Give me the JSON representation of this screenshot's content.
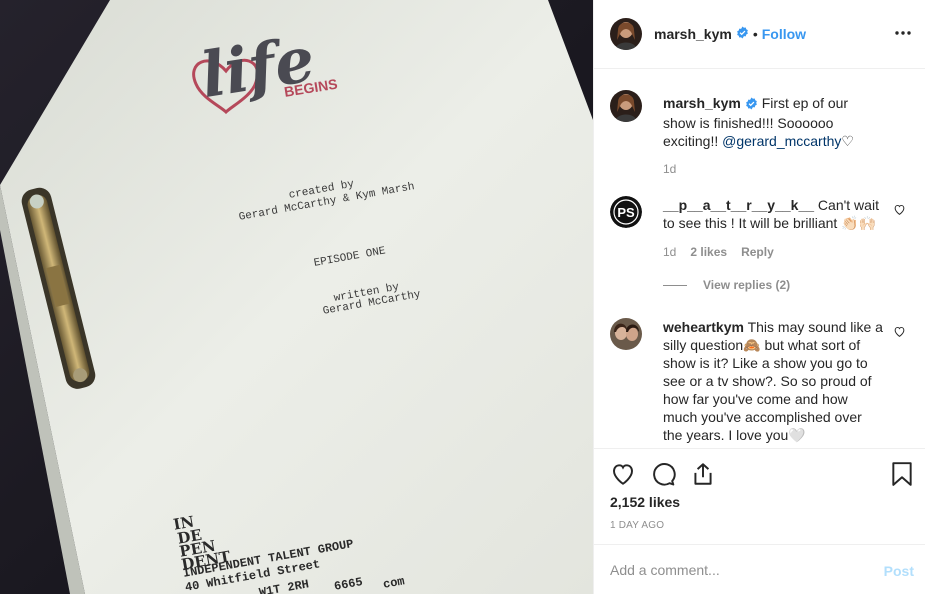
{
  "photo": {
    "logo": {
      "script_word": "life",
      "word": "BEGINS"
    },
    "script_lines": {
      "created_by": "created by",
      "authors": "Gerard McCarthy & Kym Marsh",
      "episode": "EPISODE ONE",
      "written_by": "written by",
      "writer": "Gerard McCarthy"
    },
    "agency_logo": [
      "IN",
      "DE",
      "PEN",
      "DENT"
    ],
    "address": [
      "INDEPENDENT TALENT GROUP",
      "40 Whitfield Street",
      "W1T 2RH",
      "6665",
      "com"
    ]
  },
  "header": {
    "username": "marsh_kym",
    "separator": "•",
    "follow_label": "Follow"
  },
  "caption": {
    "username": "marsh_kym",
    "text": "First ep of our show is finished!!! Soooooo exciting!! ",
    "mention": "@gerard_mccarthy",
    "emoji": "♡",
    "age": "1d"
  },
  "comments": [
    {
      "username": "__p__a__t__r__y__k__",
      "text": "Can't wait to see this ! It will be brilliant 👏🏻🙌🏻",
      "age": "1d",
      "likes": "2 likes",
      "reply": "Reply",
      "view_replies": "View replies (2)"
    },
    {
      "username": "weheartkym",
      "text": "This may sound like a silly question🙈 but what sort of show is it? Like a show you go to see or a tv show?. So so proud of how far you've come and how much you've accomplished over the years. I love you🤍"
    }
  ],
  "stats": {
    "likes": "2,152 likes",
    "time_ago": "1 DAY AGO"
  },
  "add_comment": {
    "placeholder": "Add a comment...",
    "post_label": "Post"
  },
  "colors": {
    "link_blue": "#3897f0",
    "mention_blue": "#003569",
    "post_disabled": "#b2dffc",
    "logo_gray": "#4a4a52",
    "logo_red": "#b5485a"
  },
  "icons": [
    "more-options-icon",
    "verified-badge-icon",
    "like-heart-icon",
    "comment-icon",
    "share-icon",
    "save-bookmark-icon",
    "comment-like-icon"
  ]
}
